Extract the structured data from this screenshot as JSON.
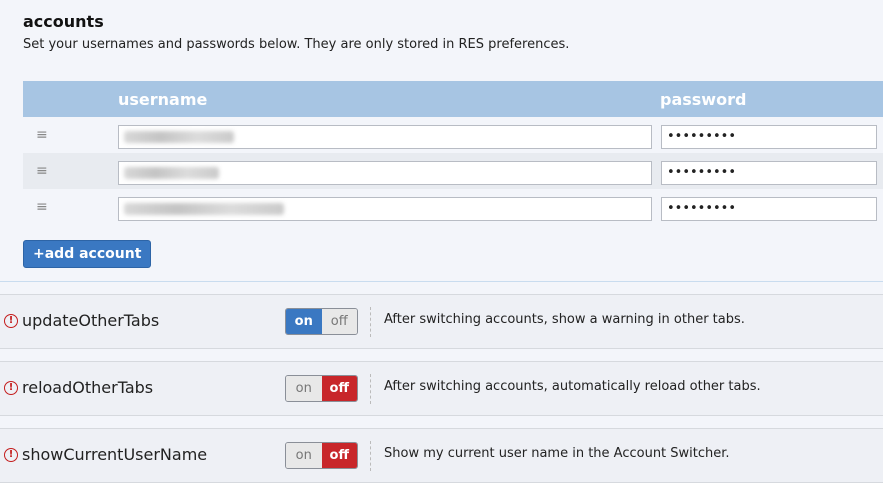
{
  "accounts": {
    "title": "accounts",
    "description": "Set your usernames and passwords below. They are only stored in RES preferences.",
    "columns": {
      "username": "username",
      "password": "password"
    },
    "rows": [
      {
        "handle": "≡",
        "password": "•••••••••"
      },
      {
        "handle": "≡",
        "password": "•••••••••"
      },
      {
        "handle": "≡",
        "password": "•••••••••"
      }
    ],
    "add_button": "+add account"
  },
  "options": [
    {
      "warn_icon": "!",
      "name": "updateOtherTabs",
      "on_label": "on",
      "off_label": "off",
      "state": "on",
      "description": "After switching accounts, show a warning in other tabs."
    },
    {
      "warn_icon": "!",
      "name": "reloadOtherTabs",
      "on_label": "on",
      "off_label": "off",
      "state": "off",
      "description": "After switching accounts, automatically reload other tabs."
    },
    {
      "warn_icon": "!",
      "name": "showCurrentUserName",
      "on_label": "on",
      "off_label": "off",
      "state": "off",
      "description": "Show my current user name in the Account Switcher."
    }
  ],
  "colors": {
    "header_bg": "#a7c5e3",
    "accent_blue": "#3a78c2",
    "off_red": "#c8262a",
    "warning_red": "#c41d1d"
  }
}
